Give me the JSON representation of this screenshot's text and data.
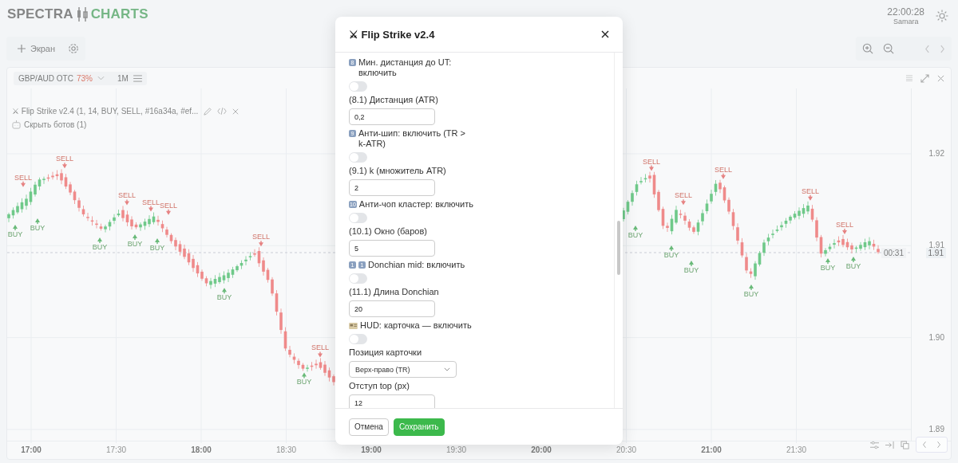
{
  "app": {
    "logo_left": "SPECTRA",
    "logo_right": "CHARTS",
    "time": "22:00:28",
    "timezone": "Samara"
  },
  "toolbar": {
    "add_label": "Экран"
  },
  "chart": {
    "symbol": "GBP/AUD OTC",
    "payout": "73%",
    "timeframe": "1M",
    "indicator": "⚔ Flip Strike v2.4 (1, 14, BUY, SELL, #16a34a, #ef...",
    "bots_toggle": "Скрыть ботов (1)",
    "yticks": [
      "1.92",
      "1.91",
      "1.90",
      "1.89"
    ],
    "price": "1.91",
    "countdown": "00:31",
    "xticks": [
      {
        "label": "17:00",
        "major": true
      },
      {
        "label": "17:30",
        "major": false
      },
      {
        "label": "18:00",
        "major": true
      },
      {
        "label": "18:30",
        "major": false
      },
      {
        "label": "19:00",
        "major": true
      },
      {
        "label": "19:30",
        "major": false
      },
      {
        "label": "20:00",
        "major": true
      },
      {
        "label": "20:30",
        "major": false
      },
      {
        "label": "21:00",
        "major": true
      },
      {
        "label": "21:30",
        "major": false
      }
    ],
    "signals": [
      {
        "kind": "sell",
        "label": "SELL"
      },
      {
        "kind": "buy",
        "label": "BUY"
      },
      {
        "kind": "buy",
        "label": "BUY"
      },
      {
        "kind": "sell",
        "label": "SELL"
      },
      {
        "kind": "buy",
        "label": "BUY"
      },
      {
        "kind": "sell",
        "label": "SELL"
      },
      {
        "kind": "buy",
        "label": "BUY"
      },
      {
        "kind": "sell",
        "label": "SELL"
      },
      {
        "kind": "buy",
        "label": "BUY"
      },
      {
        "kind": "sell",
        "label": "SELL"
      },
      {
        "kind": "buy",
        "label": "BUY"
      },
      {
        "kind": "sell",
        "label": "SELL"
      },
      {
        "kind": "buy",
        "label": "BUY"
      },
      {
        "kind": "sell",
        "label": "SELL"
      },
      {
        "kind": "buy",
        "label": "BUY"
      },
      {
        "kind": "sell",
        "label": "SELL"
      },
      {
        "kind": "buy",
        "label": "BUY"
      },
      {
        "kind": "sell",
        "label": "SELL"
      },
      {
        "kind": "buy",
        "label": "BUY"
      },
      {
        "kind": "sell",
        "label": "SELL"
      },
      {
        "kind": "buy",
        "label": "BUY"
      },
      {
        "kind": "sell",
        "label": "SELL"
      },
      {
        "kind": "buy",
        "label": "BUY"
      },
      {
        "kind": "sell",
        "label": "SELL"
      },
      {
        "kind": "buy",
        "label": "BUY"
      }
    ]
  },
  "dialog": {
    "title": "⚔ Flip Strike v2.4",
    "settings": [
      {
        "kind": "toggle",
        "badges": [
          "8"
        ],
        "label": "Мин. дистанция до UT: включить",
        "on": false
      },
      {
        "kind": "number",
        "label": "(8.1) Дистанция (ATR)",
        "value": "0,2"
      },
      {
        "kind": "toggle",
        "badges": [
          "9"
        ],
        "label": "Анти-шип: включить (TR > k-ATR)",
        "on": false
      },
      {
        "kind": "number",
        "label": "(9.1) k (множитель ATR)",
        "value": "2"
      },
      {
        "kind": "toggle",
        "badges": [
          "10"
        ],
        "label": "Анти-чоп кластер: включить",
        "on": false
      },
      {
        "kind": "number",
        "label": "(10.1) Окно (баров)",
        "value": "5"
      },
      {
        "kind": "toggle",
        "badges": [
          "1",
          "1"
        ],
        "label": "Donchian mid: включить",
        "on": false
      },
      {
        "kind": "number",
        "label": "(11.1) Длина Donchian",
        "value": "20"
      },
      {
        "kind": "toggle",
        "label": "HUD: карточка — включить",
        "on": false
      },
      {
        "kind": "select",
        "label": "Позиция карточки",
        "value": "Верх-право (TR)"
      },
      {
        "kind": "number",
        "label": "Отступ top (px)",
        "value": "12"
      }
    ],
    "buttons": [
      {
        "label": "Отмена",
        "kind": "secondary"
      },
      {
        "label": "Сохранить",
        "kind": "primary"
      }
    ]
  }
}
